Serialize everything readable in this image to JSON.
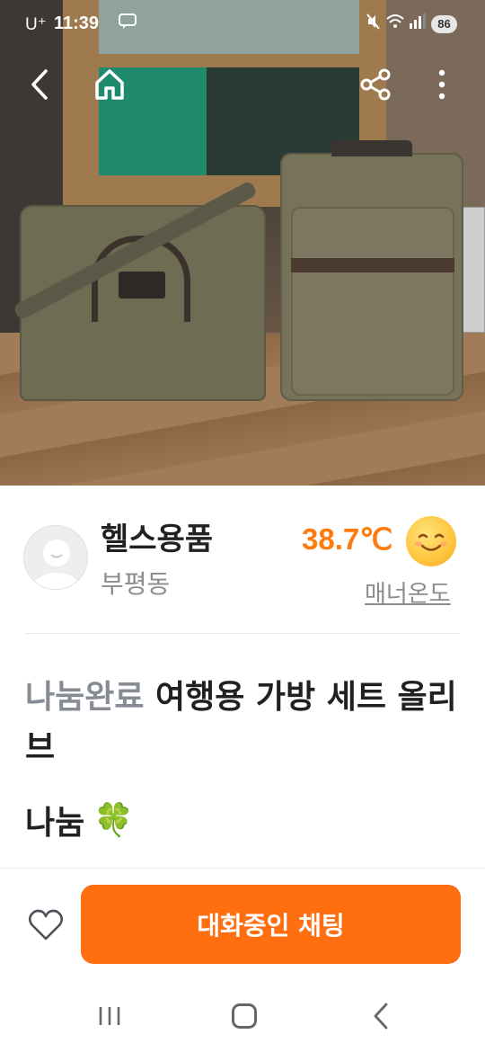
{
  "status_bar": {
    "carrier": "U⁺",
    "time": "11:39",
    "notification_icon": "message-icon",
    "battery": "86"
  },
  "nav": {
    "back_icon": "back-arrow-icon",
    "home_icon": "home-icon",
    "share_icon": "share-icon",
    "more_icon": "more-vertical-icon"
  },
  "seller": {
    "name": "헬스용품",
    "location": "부평동",
    "temperature": "38.7℃",
    "manner_label": "매너온도"
  },
  "listing": {
    "status_tag": "나눔완료",
    "title": "여행용 가방 세트 올리브",
    "price": "나눔",
    "price_emoji": "🍀"
  },
  "actions": {
    "chat_button": "대화중인 채팅"
  },
  "colors": {
    "accent": "#ff6f0f",
    "temperature": "#ff7b0e",
    "muted": "#868b94"
  }
}
